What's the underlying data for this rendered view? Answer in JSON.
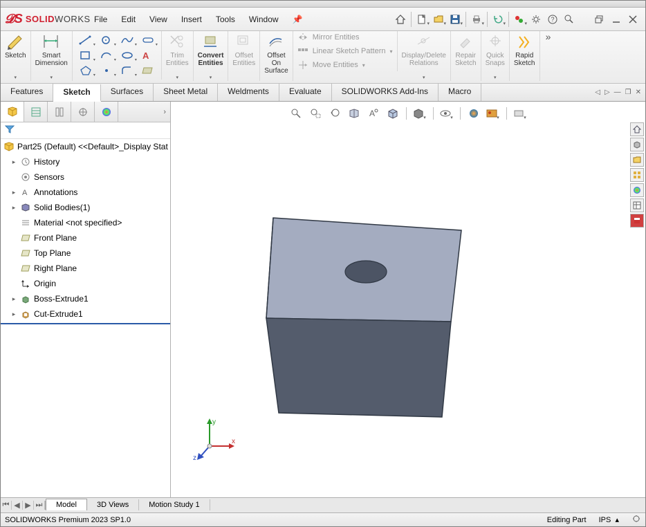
{
  "app": {
    "logo_solid": "SOLID",
    "logo_works": "WORKS"
  },
  "menu": {
    "file": "File",
    "edit": "Edit",
    "view": "View",
    "insert": "Insert",
    "tools": "Tools",
    "window": "Window"
  },
  "ribbon": {
    "sketch": "Sketch",
    "smart_dimension": "Smart\nDimension",
    "trim": "Trim\nEntities",
    "convert": "Convert\nEntities",
    "offset": "Offset\nEntities",
    "offset_on_surface": "Offset\nOn\nSurface",
    "mirror": "Mirror Entities",
    "linear_pattern": "Linear Sketch Pattern",
    "move": "Move Entities",
    "display_delete": "Display/Delete\nRelations",
    "repair": "Repair\nSketch",
    "quick_snaps": "Quick\nSnaps",
    "rapid_sketch": "Rapid\nSketch"
  },
  "tabs": {
    "features": "Features",
    "sketch": "Sketch",
    "surfaces": "Surfaces",
    "sheet_metal": "Sheet Metal",
    "weldments": "Weldments",
    "evaluate": "Evaluate",
    "addins": "SOLIDWORKS Add-Ins",
    "macro": "Macro"
  },
  "tree": {
    "root": "Part25 (Default) <<Default>_Display Stat",
    "history": "History",
    "sensors": "Sensors",
    "annotations": "Annotations",
    "solid_bodies": "Solid Bodies(1)",
    "material": "Material <not specified>",
    "front_plane": "Front Plane",
    "top_plane": "Top Plane",
    "right_plane": "Right Plane",
    "origin": "Origin",
    "boss_extrude": "Boss-Extrude1",
    "cut_extrude": "Cut-Extrude1"
  },
  "bottom": {
    "model": "Model",
    "views3d": "3D Views",
    "motion": "Motion Study 1"
  },
  "status": {
    "product": "SOLIDWORKS Premium 2023 SP1.0",
    "mode": "Editing Part",
    "units": "IPS"
  },
  "triad": {
    "x": "x",
    "y": "y",
    "z": "z"
  }
}
